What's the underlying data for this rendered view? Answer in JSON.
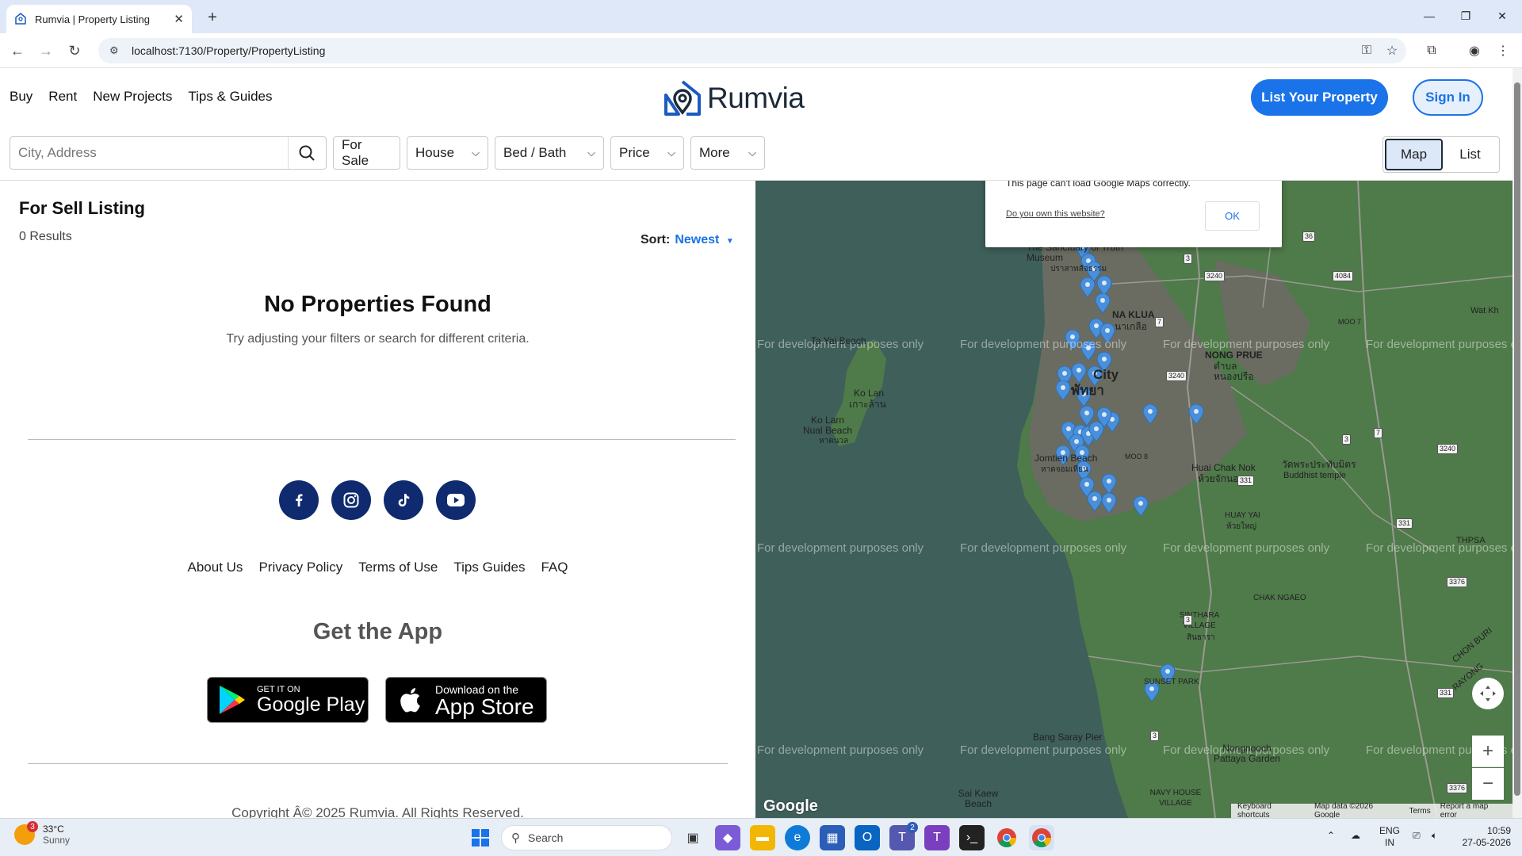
{
  "browser": {
    "tab_title": "Rumvia | Property Listing",
    "url": "localhost:7130/Property/PropertyListing"
  },
  "header": {
    "nav": [
      "Buy",
      "Rent",
      "New Projects",
      "Tips & Guides"
    ],
    "logo_text": "Rumvia",
    "list_property": "List Your Property",
    "sign_in": "Sign In"
  },
  "filters": {
    "search_placeholder": "City, Address",
    "for_sale": "For Sale",
    "house": "House",
    "bed_bath": "Bed / Bath",
    "price": "Price",
    "more": "More",
    "view_map": "Map",
    "view_list": "List"
  },
  "listing": {
    "title": "For Sell Listing",
    "results": "0 Results",
    "sort_label": "Sort:",
    "sort_value": "Newest",
    "empty_title": "No Properties Found",
    "empty_subtitle": "Try adjusting your filters or search for different criteria."
  },
  "footer": {
    "links": [
      "About Us",
      "Privacy Policy",
      "Terms of Use",
      "Tips Guides",
      "FAQ"
    ],
    "get_app": "Get the App",
    "google_small": "GET IT ON",
    "google_big": "Google Play",
    "apple_small": "Download on the",
    "apple_big": "App Store",
    "copyright": "Copyright Â© 2025 Rumvia. All Rights Reserved."
  },
  "map": {
    "dialog_message": "This page can't load Google Maps correctly.",
    "dialog_link": "Do you own this website?",
    "dialog_ok": "OK",
    "watermark": "For development purposes only",
    "labels": {
      "sanctuary": "The Sanctuary of Truth Museum",
      "sanctuary_thai": "ปราสาทสัจธรรม",
      "naklua": "NA KLUA",
      "naklua_thai": "นาเกลือ",
      "nongprue": "NONG PRUE",
      "nongprue_thai": "ตำบล หนองปรือ",
      "city": "City",
      "pattaya_thai": "พัทยา",
      "koyai": "Ta Yai Beach",
      "kolan": "Ko Lan",
      "kolan_thai": "เกาะล้าน",
      "nual": "Ko Larn Nual Beach",
      "nual_thai": "หาดนวล",
      "jomtien": "Jomtien Beach",
      "jomtien_thai": "หาดจอมเทียน",
      "huaichak": "Huai Chak Nok",
      "huaichak_thai": "ห้วยจักนอก",
      "temple_thai": "วัดพระประทับมิตร",
      "temple": "Buddhist temple",
      "huayyai": "HUAY YAI",
      "huayyai_thai": "ห้วยใหญ่",
      "chakngaeo": "CHAK NGAEO",
      "sinthara": "SINTHARA VILLAGE",
      "sinthara_thai": "สินธารา",
      "sunset": "SUNSET PARK",
      "bangsaray": "Bang Saray Pier",
      "nongnooch": "Nongnooch Pattaya Garden",
      "saikaew": "Sai Kaew Beach",
      "navyhouse": "NAVY HOUSE VILLAGE",
      "chonburi": "CHON BURI",
      "rayong": "RAYONG",
      "thpsa": "THPSA",
      "watkh": "Wat Kh",
      "moo8": "MOO 8",
      "moo7": "MOO 7"
    },
    "road_numbers": [
      "3",
      "36",
      "3240",
      "7",
      "4084",
      "3240",
      "3",
      "3240",
      "331",
      "7",
      "3",
      "331",
      "3",
      "331",
      "3376",
      "3376"
    ],
    "footer_links": [
      "Keyboard shortcuts",
      "Map data ©2026 Google",
      "Terms",
      "Report a map error"
    ],
    "google_logo": "Google",
    "zoom_in": "+",
    "zoom_out": "−",
    "colors": {
      "water": "#3e5f5a",
      "land": "#4f7a4a",
      "urban": "#6e6e66",
      "marker": "#4a8fd9"
    }
  },
  "taskbar": {
    "weather_temp": "33°C",
    "weather_desc": "Sunny",
    "weather_badge": "3",
    "search": "Search",
    "teams_badge": "2",
    "lang": "ENG",
    "region": "IN",
    "time": "10:59",
    "date": "27-05-2026"
  }
}
